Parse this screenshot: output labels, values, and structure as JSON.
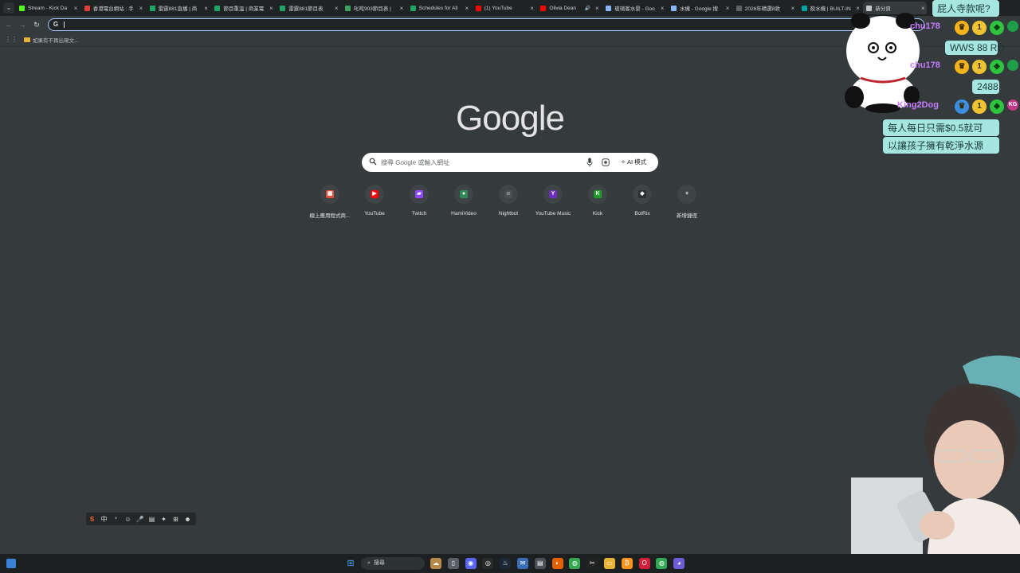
{
  "window": {
    "tabs": [
      {
        "title": "Stream - Kick Da",
        "icon": "kick-icon",
        "color": "#53fc18",
        "active": false
      },
      {
        "title": "香港電台網站 : 手",
        "icon": "rthk-icon",
        "color": "#e33a3a",
        "active": false
      },
      {
        "title": "雷霆881直播 | 商",
        "icon": "sheet-icon",
        "color": "#1fa463",
        "active": false
      },
      {
        "title": "節目重溫 | 商業電",
        "icon": "sheet-icon",
        "color": "#1fa463",
        "active": false
      },
      {
        "title": "雷霆881節目表",
        "icon": "sheet-icon",
        "color": "#1fa463",
        "active": false
      },
      {
        "title": "叱咤903節目表 |",
        "icon": "radio-icon",
        "color": "#3da35d",
        "active": false
      },
      {
        "title": "Schedules for All",
        "icon": "sheet-icon",
        "color": "#1fa463",
        "active": false
      },
      {
        "title": "(1) YouTube",
        "icon": "youtube-icon",
        "color": "#ff0000",
        "active": false
      },
      {
        "title": "Olivia Dean",
        "icon": "youtube-icon",
        "color": "#ff0000",
        "active": false,
        "audio": true
      },
      {
        "title": "玻璃客水景 - Goo",
        "icon": "google-icon",
        "color": "#8ab4f8",
        "active": false
      },
      {
        "title": "水機 - Google 搜",
        "icon": "google-icon",
        "color": "#8ab4f8",
        "active": false
      },
      {
        "title": "2026年精選8款",
        "icon": "doc-icon",
        "color": "#5f6368",
        "active": false
      },
      {
        "title": "飲水機 | BUILT-IN",
        "icon": "bookmark-icon",
        "color": "#00a3a3",
        "active": false
      },
      {
        "title": "新分頁",
        "icon": "chrome-icon",
        "color": "#c8c8c8",
        "active": true
      }
    ],
    "close_glyph": "×",
    "menu_glyph": "⌄"
  },
  "toolbar": {
    "back": "←",
    "forward": "→",
    "reload": "↻",
    "omnibox_icon": "G",
    "omnibox_value": ""
  },
  "bookmarks_bar": {
    "apps_glyph": "⋮⋮",
    "notice": "如果有不再出現文..."
  },
  "ntp": {
    "logo": "Google",
    "search_placeholder": "搜尋 Google 或輸入網址",
    "ai_mode_label": "AI 模式",
    "shortcuts": [
      {
        "label": "線上應用程式商...",
        "icon": "webstore-icon",
        "color": "#e44c3a",
        "glyph": "▦"
      },
      {
        "label": "YouTube",
        "icon": "youtube-icon",
        "color": "#ff0000",
        "glyph": "▶"
      },
      {
        "label": "Twitch",
        "icon": "twitch-icon",
        "color": "#9146ff",
        "glyph": "▰"
      },
      {
        "label": "HamiVideo",
        "icon": "hamivideo-icon",
        "color": "#2e8b57",
        "glyph": "●"
      },
      {
        "label": "Nightbot",
        "icon": "nightbot-icon",
        "color": "#4a4f52",
        "glyph": "☺"
      },
      {
        "label": "YouTube Music",
        "icon": "youtube-music-icon",
        "color": "#6b2fbf",
        "glyph": "Y"
      },
      {
        "label": "Kick",
        "icon": "kick-icon",
        "color": "#1e9b2a",
        "glyph": "K"
      },
      {
        "label": "BotRix",
        "icon": "botrix-icon",
        "color": "#2a2f30",
        "glyph": "◆"
      },
      {
        "label": "新增捷徑",
        "icon": "add-shortcut-icon",
        "color": "#3f4547",
        "glyph": "+"
      }
    ]
  },
  "ime": {
    "items": [
      "S",
      "中",
      "⁺",
      "☺",
      "🎤",
      "▤",
      "✦",
      "⊞",
      "☻"
    ]
  },
  "taskbar": {
    "search_label": "搜尋",
    "search_glyph": "⌕",
    "apps": [
      {
        "name": "widget-icon",
        "color": "#b88a4a",
        "glyph": "☁"
      },
      {
        "name": "file-icon",
        "color": "#5a6066",
        "glyph": "▯"
      },
      {
        "name": "discord-icon",
        "color": "#5865f2",
        "glyph": "◉"
      },
      {
        "name": "obs-icon",
        "color": "#2b2b2b",
        "glyph": "◎"
      },
      {
        "name": "steam-icon",
        "color": "#1b2838",
        "glyph": "♨"
      },
      {
        "name": "mail-icon",
        "color": "#3c6eb4",
        "glyph": "✉"
      },
      {
        "name": "app-icon",
        "color": "#4b5056",
        "glyph": "▤"
      },
      {
        "name": "firefox-icon",
        "color": "#e66000",
        "glyph": "◐"
      },
      {
        "name": "chrome-icon",
        "color": "#34a853",
        "glyph": "◍"
      },
      {
        "name": "capcut-icon",
        "color": "#222",
        "glyph": "✂"
      },
      {
        "name": "folder-icon",
        "color": "#e8b339",
        "glyph": "▭"
      },
      {
        "name": "bitcoin-icon",
        "color": "#f7931a",
        "glyph": "₿"
      },
      {
        "name": "opera-icon",
        "color": "#d21f3c",
        "glyph": "O"
      },
      {
        "name": "chrome-active-icon",
        "color": "#34a853",
        "glyph": "◍"
      },
      {
        "name": "streamlabs-icon",
        "color": "#6f5bd6",
        "glyph": "◕"
      }
    ]
  },
  "stream_overlay": {
    "chat": [
      {
        "kind": "message",
        "text": "屁人寺款呢?"
      },
      {
        "kind": "user",
        "name": "chu178"
      },
      {
        "kind": "message",
        "text": "WWS 88 RO"
      },
      {
        "kind": "user",
        "name": "chu178"
      },
      {
        "kind": "message",
        "text": "2488"
      },
      {
        "kind": "user",
        "name": "King2Dog"
      },
      {
        "kind": "message",
        "text": "每人每日只需$0.5就可"
      },
      {
        "kind": "message",
        "text": "以讓孩子擁有乾淨水源"
      }
    ],
    "badge_colors": {
      "crown": "#f3b41b",
      "one": "#f0c430",
      "diamond": "#2fc43f",
      "blue": "#3b8fe0"
    },
    "badge_glyphs": {
      "one": "1",
      "diamond": "◆",
      "crown": "♛",
      "blue": "♛",
      "kg": "KG"
    }
  }
}
